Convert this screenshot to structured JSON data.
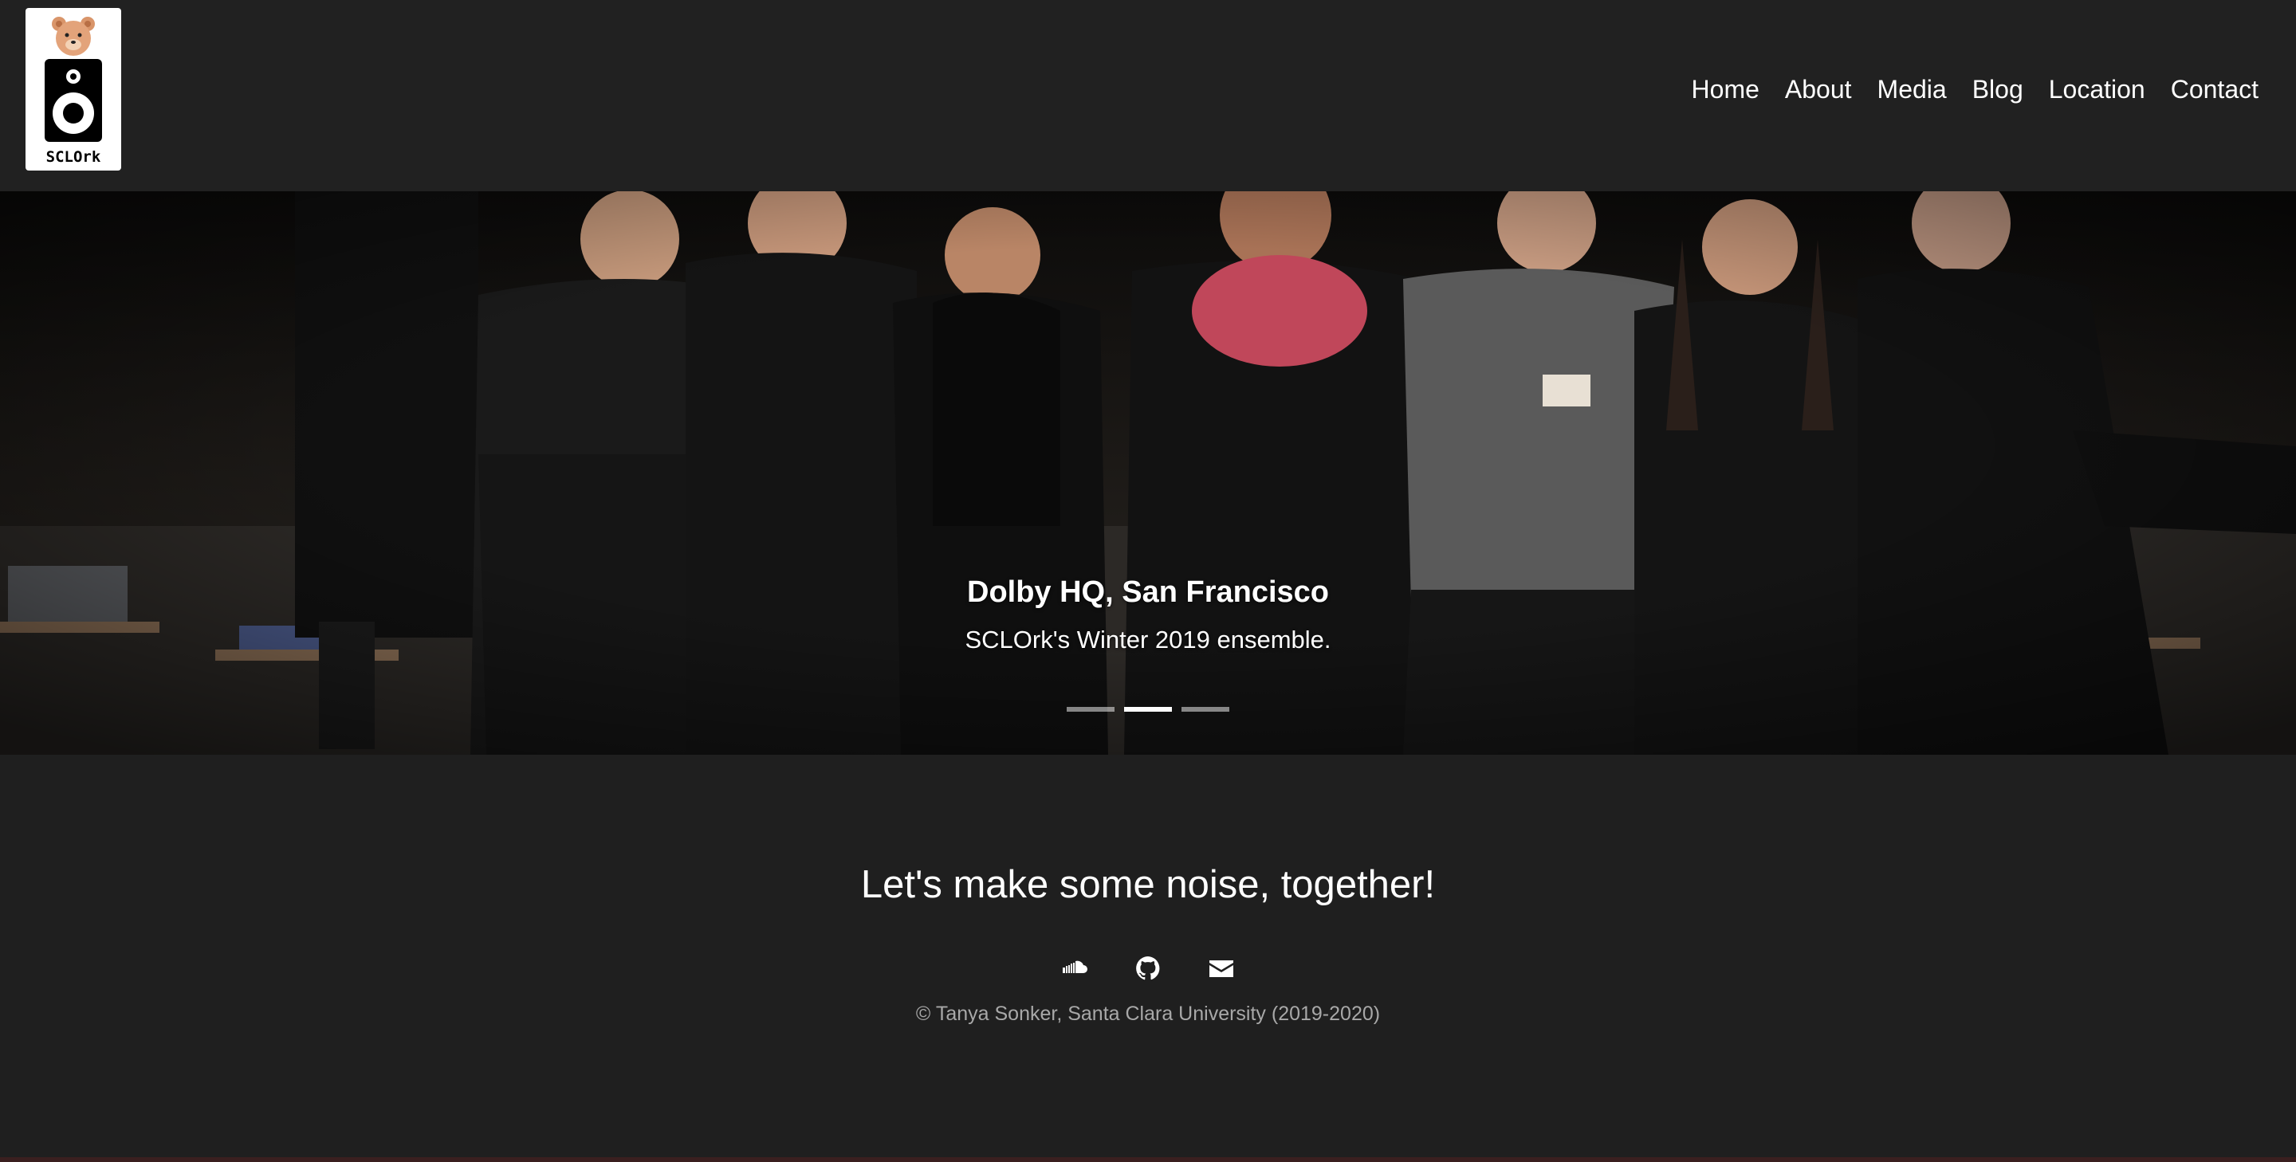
{
  "brand": {
    "logo_text": "SCLOrk",
    "logo_icon": "teddy-bear-speaker-logo"
  },
  "nav": {
    "items": [
      {
        "label": "Home"
      },
      {
        "label": "About"
      },
      {
        "label": "Media"
      },
      {
        "label": "Blog"
      },
      {
        "label": "Location"
      },
      {
        "label": "Contact"
      }
    ]
  },
  "carousel": {
    "caption_title": "Dolby HQ, San Francisco",
    "caption_subtitle": "SCLOrk's Winter 2019 ensemble.",
    "slide_count": 3,
    "active_slide": 2
  },
  "footer": {
    "tagline": "Let's make some noise, together!",
    "social_icons": [
      "soundcloud-icon",
      "github-icon",
      "envelope-icon"
    ],
    "copyright": "© Tanya Sonker, Santa Clara University (2019-2020)"
  },
  "colors": {
    "background": "#1f1f1f",
    "navbar": "#212121",
    "text": "#ffffff",
    "muted_text": "#a8a8a8"
  }
}
